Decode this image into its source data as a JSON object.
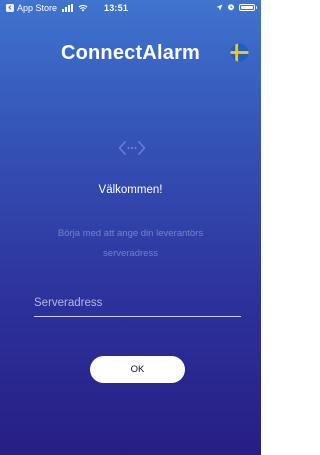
{
  "status_bar": {
    "back_app": "App Store",
    "time": "13:51"
  },
  "header": {
    "title": "ConnectAlarm",
    "language_flag": "sweden-flag-icon"
  },
  "main": {
    "icon": "code-icon",
    "welcome": "Välkommen!",
    "instruction": "Börja med att ange din leverantörs serveradress",
    "server_input": {
      "placeholder": "Serveradress",
      "value": ""
    },
    "ok_label": "OK"
  },
  "colors": {
    "gradient_top": "#3f74cf",
    "gradient_bottom": "#261e84",
    "flag_blue": "#1f5fbf",
    "flag_yellow": "#f5c518",
    "button_bg": "#ffffff"
  }
}
